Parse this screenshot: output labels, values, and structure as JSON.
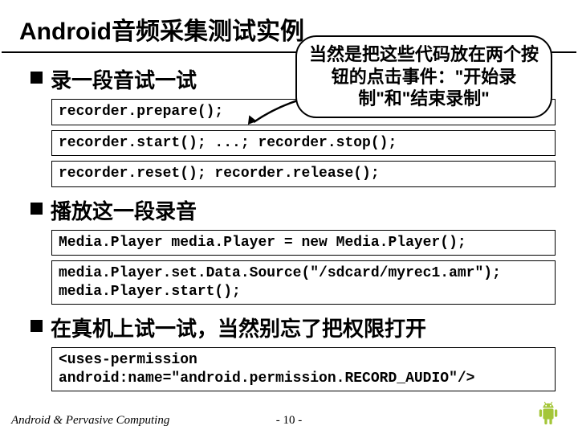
{
  "title": "Android音频采集测试实例",
  "callout": "当然是把这些代码放在两个按钮的点击事件：\"开始录制\"和\"结束录制\"",
  "sections": [
    {
      "bullet": "录一段音试一试",
      "code_lines": [
        "recorder.prepare();",
        "recorder.start(); ...; recorder.stop();",
        "recorder.reset(); recorder.release();"
      ]
    },
    {
      "bullet": "播放这一段录音",
      "code_lines": [
        "Media.Player media.Player = new Media.Player();",
        "media.Player.set.Data.Source(\"/sdcard/myrec1.amr\");\nmedia.Player.start();"
      ]
    },
    {
      "bullet": "在真机上试一试，当然别忘了把权限打开",
      "code_lines": [
        "<uses-permission\nandroid:name=\"android.permission.RECORD_AUDIO\"/>"
      ]
    }
  ],
  "footer_left": "Android & Pervasive Computing",
  "footer_center": "- 10 -"
}
